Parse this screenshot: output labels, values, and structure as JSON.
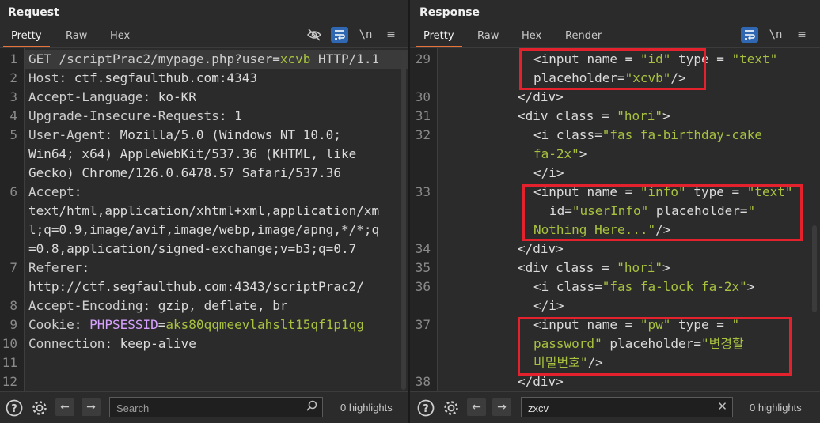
{
  "request": {
    "title": "Request",
    "tabs": [
      "Pretty",
      "Raw",
      "Hex"
    ],
    "active_tab": "Pretty",
    "tools": [
      "hide-nonprinting-icon",
      "wrap-lines-icon",
      "newline-icon",
      "menu-icon"
    ],
    "lines": [
      {
        "n": "1",
        "parts": [
          [
            "GET /scriptPrac2/mypage.php?",
            "k"
          ],
          [
            "user",
            "k"
          ],
          [
            "=",
            "k"
          ],
          [
            "xcvb",
            "hl"
          ],
          [
            " HTTP/1.1",
            "k"
          ]
        ]
      },
      {
        "n": "2",
        "parts": [
          [
            "Host",
            "k"
          ],
          [
            ": ctf.segfaulthub.com:4343",
            "v"
          ]
        ]
      },
      {
        "n": "3",
        "parts": [
          [
            "Accept-Language",
            "k"
          ],
          [
            ": ko-KR",
            "v"
          ]
        ]
      },
      {
        "n": "4",
        "parts": [
          [
            "Upgrade-Insecure-Requests",
            "k"
          ],
          [
            ": 1",
            "v"
          ]
        ]
      },
      {
        "n": "5",
        "parts": [
          [
            "User-Agent",
            "k"
          ],
          [
            ": Mozilla/5.0 (Windows NT 10.0;",
            "v"
          ]
        ]
      },
      {
        "n": "",
        "parts": [
          [
            "Win64; x64) AppleWebKit/537.36 (KHTML, like",
            "v"
          ]
        ]
      },
      {
        "n": "",
        "parts": [
          [
            "Gecko) Chrome/126.0.6478.57 Safari/537.36",
            "v"
          ]
        ]
      },
      {
        "n": "6",
        "parts": [
          [
            "Accept",
            "k"
          ],
          [
            ":",
            "v"
          ]
        ]
      },
      {
        "n": "",
        "parts": [
          [
            "text/html,application/xhtml+xml,application/xm",
            "v"
          ]
        ]
      },
      {
        "n": "",
        "parts": [
          [
            "l;q=0.9,image/avif,image/webp,image/apng,*/*;q",
            "v"
          ]
        ]
      },
      {
        "n": "",
        "parts": [
          [
            "=0.8,application/signed-exchange;v=b3;q=0.7",
            "v"
          ]
        ]
      },
      {
        "n": "7",
        "parts": [
          [
            "Referer",
            "k"
          ],
          [
            ":",
            "v"
          ]
        ]
      },
      {
        "n": "",
        "parts": [
          [
            "http://ctf.segfaulthub.com:4343/scriptPrac2/",
            "v"
          ]
        ]
      },
      {
        "n": "8",
        "parts": [
          [
            "Accept-Encoding",
            "k"
          ],
          [
            ": gzip, deflate, br",
            "v"
          ]
        ]
      },
      {
        "n": "9",
        "parts": [
          [
            "Cookie",
            "k"
          ],
          [
            ": ",
            "v"
          ],
          [
            "PHPSESSID",
            "hv"
          ],
          [
            "=",
            "v"
          ],
          [
            "aks80qqmeevlahslt15qf1p1qg",
            "hl"
          ]
        ]
      },
      {
        "n": "10",
        "parts": [
          [
            "Connection",
            "k"
          ],
          [
            ": keep-alive",
            "v"
          ]
        ]
      },
      {
        "n": "11",
        "parts": []
      },
      {
        "n": "12",
        "parts": []
      }
    ],
    "footer": {
      "search_placeholder": "Search",
      "search_value": "",
      "highlights": "0 highlights"
    }
  },
  "response": {
    "title": "Response",
    "tabs": [
      "Pretty",
      "Raw",
      "Hex",
      "Render"
    ],
    "active_tab": "Pretty",
    "tools": [
      "wrap-lines-icon",
      "newline-icon",
      "menu-icon"
    ],
    "lines": [
      {
        "n": "29",
        "ind": 6,
        "parts": [
          [
            "<input ",
            "tag"
          ],
          [
            "name",
            "attr"
          ],
          [
            " = ",
            "tag"
          ],
          [
            "\"id\"",
            "str"
          ],
          [
            " ",
            "tag"
          ],
          [
            "type",
            "attr"
          ],
          [
            " = ",
            "tag"
          ],
          [
            "\"text\"",
            "str"
          ]
        ]
      },
      {
        "n": "",
        "ind": 6,
        "parts": [
          [
            "placeholder",
            "attr"
          ],
          [
            "=",
            "tag"
          ],
          [
            "\"xcvb\"",
            "str"
          ],
          [
            "/>",
            "tag"
          ]
        ]
      },
      {
        "n": "30",
        "ind": 5,
        "parts": [
          [
            "</div>",
            "tag"
          ]
        ]
      },
      {
        "n": "31",
        "ind": 5,
        "parts": [
          [
            "<div ",
            "tag"
          ],
          [
            "class",
            "attr"
          ],
          [
            " = ",
            "tag"
          ],
          [
            "\"hori\"",
            "str"
          ],
          [
            ">",
            "tag"
          ]
        ]
      },
      {
        "n": "32",
        "ind": 6,
        "parts": [
          [
            "<i ",
            "tag"
          ],
          [
            "class",
            "attr"
          ],
          [
            "=",
            "tag"
          ],
          [
            "\"fas fa-birthday-cake",
            "str"
          ]
        ]
      },
      {
        "n": "",
        "ind": 6,
        "parts": [
          [
            "fa-2x\"",
            "str"
          ],
          [
            ">",
            "tag"
          ]
        ]
      },
      {
        "n": "",
        "ind": 6,
        "parts": [
          [
            "</i>",
            "tag"
          ]
        ]
      },
      {
        "n": "33",
        "ind": 6,
        "parts": [
          [
            "<input ",
            "tag"
          ],
          [
            "name",
            "attr"
          ],
          [
            " = ",
            "tag"
          ],
          [
            "\"info\"",
            "str"
          ],
          [
            " ",
            "tag"
          ],
          [
            "type",
            "attr"
          ],
          [
            " = ",
            "tag"
          ],
          [
            "\"text\"",
            "str"
          ]
        ]
      },
      {
        "n": "",
        "ind": 7,
        "parts": [
          [
            "id",
            "attr"
          ],
          [
            "=",
            "tag"
          ],
          [
            "\"userInfo\"",
            "str"
          ],
          [
            " ",
            "tag"
          ],
          [
            "placeholder",
            "attr"
          ],
          [
            "=",
            "tag"
          ],
          [
            "\"",
            "str"
          ]
        ]
      },
      {
        "n": "",
        "ind": 6,
        "parts": [
          [
            "Nothing Here...\"",
            "str"
          ],
          [
            "/>",
            "tag"
          ]
        ]
      },
      {
        "n": "34",
        "ind": 5,
        "parts": [
          [
            "</div>",
            "tag"
          ]
        ]
      },
      {
        "n": "35",
        "ind": 5,
        "parts": [
          [
            "<div ",
            "tag"
          ],
          [
            "class",
            "attr"
          ],
          [
            " = ",
            "tag"
          ],
          [
            "\"hori\"",
            "str"
          ],
          [
            ">",
            "tag"
          ]
        ]
      },
      {
        "n": "36",
        "ind": 6,
        "parts": [
          [
            "<i ",
            "tag"
          ],
          [
            "class",
            "attr"
          ],
          [
            "=",
            "tag"
          ],
          [
            "\"fas fa-lock fa-2x\"",
            "str"
          ],
          [
            ">",
            "tag"
          ]
        ]
      },
      {
        "n": "",
        "ind": 6,
        "parts": [
          [
            "</i>",
            "tag"
          ]
        ]
      },
      {
        "n": "37",
        "ind": 6,
        "parts": [
          [
            "<input ",
            "tag"
          ],
          [
            "name",
            "attr"
          ],
          [
            " = ",
            "tag"
          ],
          [
            "\"pw\"",
            "str"
          ],
          [
            " ",
            "tag"
          ],
          [
            "type",
            "attr"
          ],
          [
            " = ",
            "tag"
          ],
          [
            "\"",
            "str"
          ]
        ]
      },
      {
        "n": "",
        "ind": 6,
        "parts": [
          [
            "password\"",
            "str"
          ],
          [
            " ",
            "tag"
          ],
          [
            "placeholder",
            "attr"
          ],
          [
            "=",
            "tag"
          ],
          [
            "\"변경할",
            "str"
          ]
        ]
      },
      {
        "n": "",
        "ind": 6,
        "parts": [
          [
            "비밀번호\"",
            "str"
          ],
          [
            "/>",
            "tag"
          ]
        ]
      },
      {
        "n": "38",
        "ind": 5,
        "parts": [
          [
            "</div>",
            "tag"
          ]
        ]
      }
    ],
    "footer": {
      "search_placeholder": "",
      "search_value": "zxcv",
      "highlights": "0 highlights"
    }
  },
  "colors": {
    "accent_tab": "#e8743b",
    "active_tool": "#2f67b2",
    "string_green": "#a8c23f",
    "session_key": "#d7a1ff",
    "highlight_box": "#e3222e"
  }
}
